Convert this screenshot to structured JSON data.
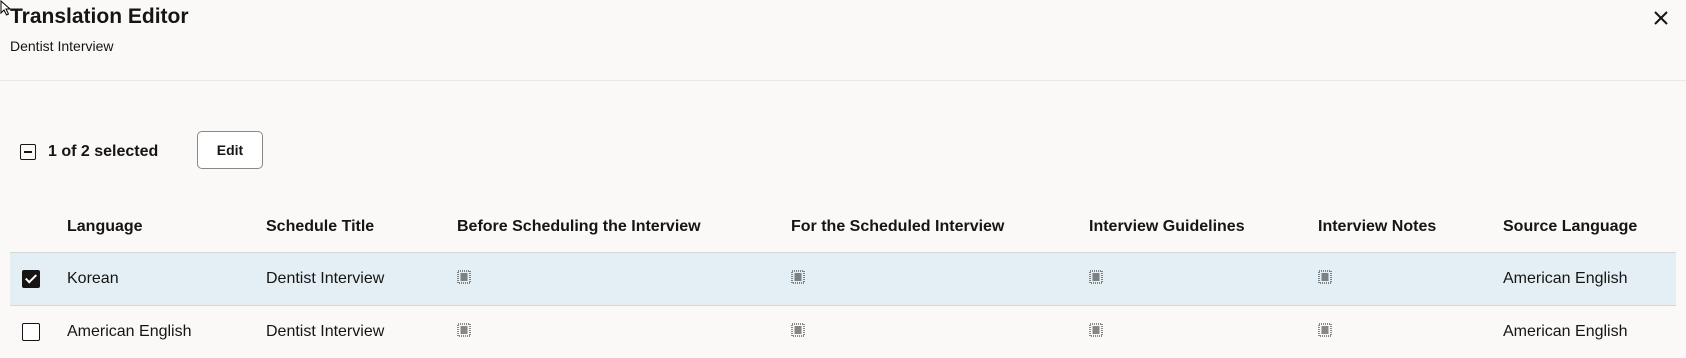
{
  "dialog": {
    "title": "Translation Editor",
    "subtitle": "Dentist Interview",
    "close_icon": "close-icon"
  },
  "toolbar": {
    "selection_text": "1 of 2 selected",
    "edit_label": "Edit"
  },
  "table": {
    "columns": [
      "Language",
      "Schedule Title",
      "Before Scheduling the Interview",
      "For the Scheduled Interview",
      "Interview Guidelines",
      "Interview Notes",
      "Source Language"
    ],
    "rows": [
      {
        "selected": true,
        "language": "Korean",
        "schedule_title": "Dentist Interview",
        "source_language": "American English"
      },
      {
        "selected": false,
        "language": "American English",
        "schedule_title": "Dentist Interview",
        "source_language": "American English"
      }
    ]
  },
  "colors": {
    "selected_row_bg": "#e3eff5",
    "page_bg": "#faf9f8"
  }
}
